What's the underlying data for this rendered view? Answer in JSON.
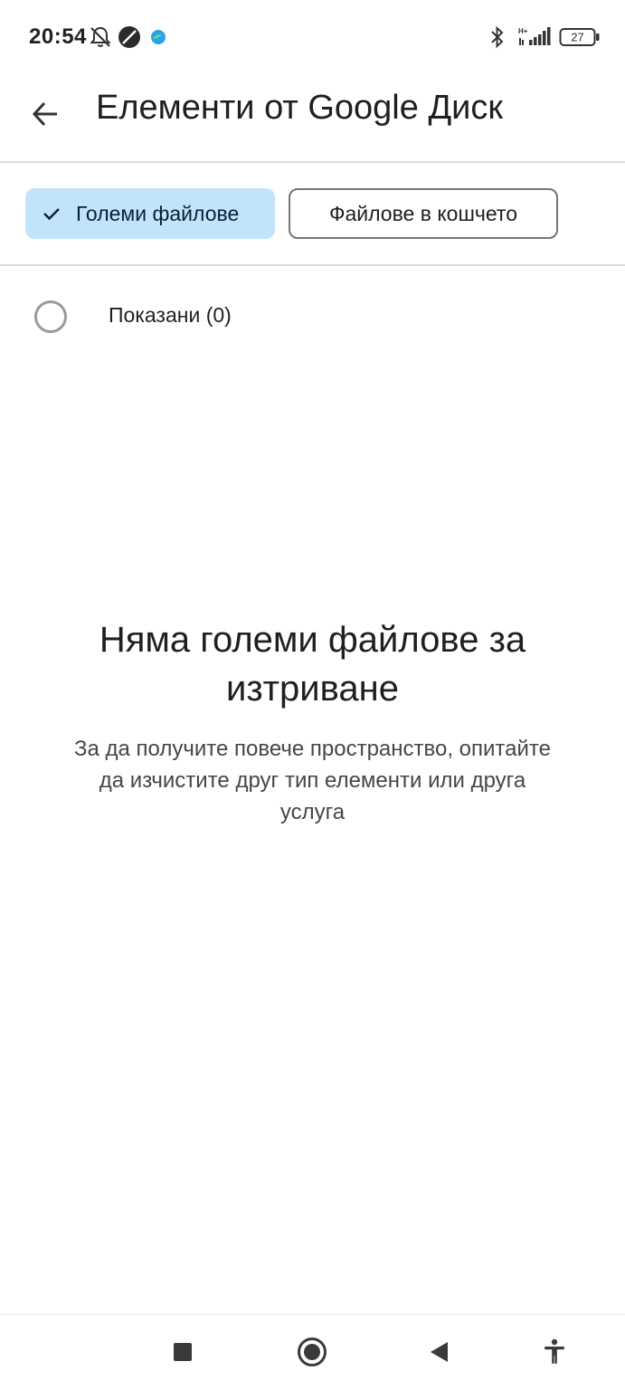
{
  "status_bar": {
    "time": "20:54",
    "battery_level": "27",
    "network_label": "H+",
    "icons": [
      "mute-icon",
      "app-icon",
      "edge-icon",
      "bluetooth-icon",
      "signal-icon",
      "battery-icon"
    ]
  },
  "app_bar": {
    "title": "Елементи от Google Диск",
    "back_icon": "arrow-back-icon"
  },
  "filters": {
    "chips": [
      {
        "label": "Големи файлове",
        "selected": true
      },
      {
        "label": "Файлове в кошчето",
        "selected": false
      }
    ]
  },
  "selection": {
    "label": "Показани (0)",
    "checked": false
  },
  "empty_state": {
    "title": "Няма големи файлове за изтриване",
    "description": "За да получите повече пространство, опитайте да изчистите друг тип елементи или друга услуга"
  },
  "nav_bar": {
    "buttons": [
      "recents-square-icon",
      "home-circle-icon",
      "back-triangle-icon",
      "accessibility-icon"
    ]
  },
  "colors": {
    "chip_selected_bg": "#c2e4fb",
    "chip_outline": "#747775",
    "divider": "#dcdcdc",
    "text_primary": "#1f1f1f",
    "text_secondary": "#444746"
  }
}
